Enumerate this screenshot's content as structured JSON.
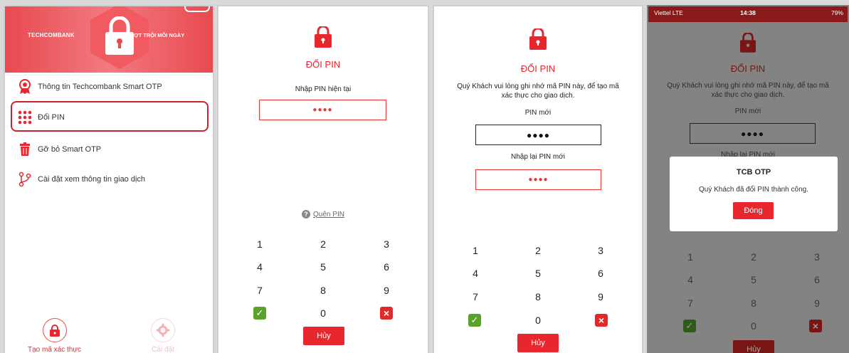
{
  "screen1": {
    "bank_name": "TECHCOMBANK",
    "slogan": "VƯỢT TRỘI   MỖI NGÀY",
    "menu": [
      {
        "label": "Thông tin Techcombank Smart OTP",
        "icon": "award-ribbon-icon"
      },
      {
        "label": "Đổi PIN",
        "icon": "keypad-icon"
      },
      {
        "label": "Gỡ bỏ Smart OTP",
        "icon": "trash-icon"
      },
      {
        "label": "Cài đặt xem thông tin giao dịch",
        "icon": "branch-icon"
      }
    ],
    "tabs": [
      {
        "label": "Tạo mã xác thực",
        "icon": "lock-icon"
      },
      {
        "label": "Cài đặt",
        "icon": "gear-icon"
      }
    ]
  },
  "screen2": {
    "title": "ĐỔI PIN",
    "current_pin_label": "Nhập PIN hiện tại",
    "pin_mask": "●●●●",
    "forgot_label": "Quên PIN",
    "keys": [
      "1",
      "2",
      "3",
      "4",
      "5",
      "6",
      "7",
      "8",
      "9",
      "0"
    ],
    "cancel_label": "Hủy"
  },
  "screen3": {
    "title": "ĐỔI PIN",
    "instruction": "Quý Khách vui lòng ghi nhớ mã PIN này, để tạo mã xác thực cho giao dịch.",
    "new_pin_label": "PIN mới",
    "new_pin_mask": "●●●●",
    "confirm_pin_label": "Nhập lại PIN mới",
    "confirm_pin_mask": "●●●●",
    "keys": [
      "1",
      "2",
      "3",
      "4",
      "5",
      "6",
      "7",
      "8",
      "9",
      "0"
    ],
    "cancel_label": "Hủy"
  },
  "screen4": {
    "status": {
      "carrier": "Viettel  LTE",
      "time": "14:38",
      "battery": "79%"
    },
    "title": "ĐỔI PIN",
    "instruction": "Quý Khách vui lòng ghi nhớ mã PIN này, để tạo mã xác thực cho giao dịch.",
    "new_pin_label": "PIN mới",
    "new_pin_mask": "●●●●",
    "confirm_pin_label": "Nhập lại PIN mới",
    "keys": [
      "1",
      "2",
      "3",
      "4",
      "5",
      "6",
      "7",
      "8",
      "9",
      "0"
    ],
    "cancel_label": "Hủy",
    "dialog": {
      "title": "TCB OTP",
      "message": "Quý Khách đã đổi PIN thành công.",
      "button": "Đóng"
    }
  },
  "colors": {
    "brand_red": "#e8262e",
    "ok_green": "#5aa22a",
    "cancel_red": "#e02a2a"
  }
}
